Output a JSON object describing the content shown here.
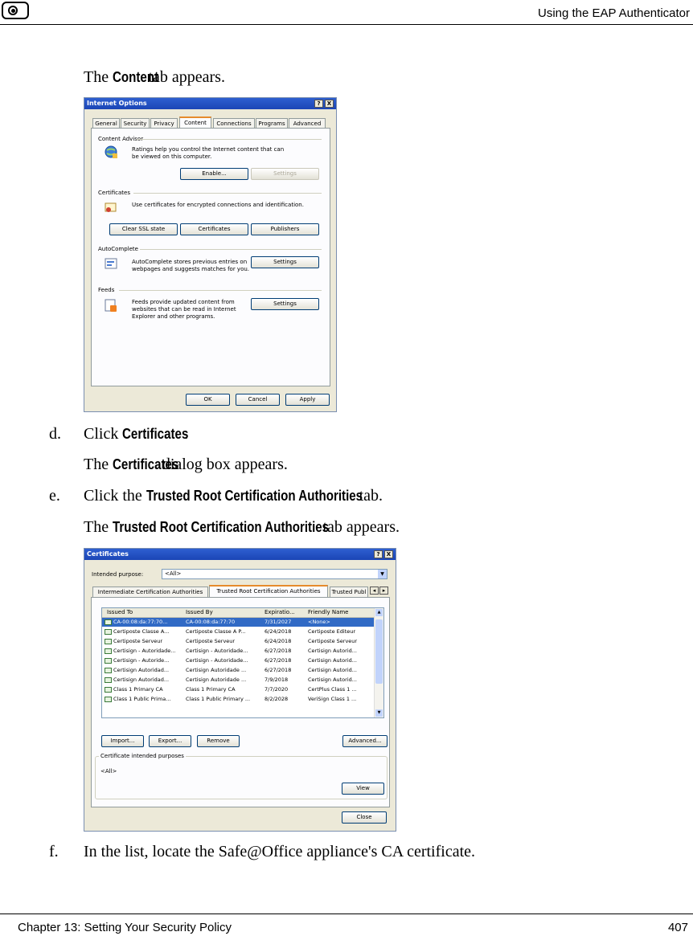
{
  "header": {
    "title": "Using the EAP Authenticator"
  },
  "footer": {
    "chapter": "Chapter 13: Setting Your Security Policy",
    "page": "407"
  },
  "steps": {
    "intro": {
      "pre": "The ",
      "bold": "Content",
      "post": " tab appears."
    },
    "d": {
      "letter": "d.",
      "pre": "Click ",
      "bold": "Certificates",
      "post": ".",
      "sub_pre": "The ",
      "sub_bold": "Certificates",
      "sub_post": " dialog box appears."
    },
    "e": {
      "letter": "e.",
      "pre": "Click the ",
      "bold": "Trusted Root Certification Authorities",
      "post": " tab.",
      "sub_pre": "The ",
      "sub_bold": "Trusted Root Certification Authorities",
      "sub_post": " tab appears."
    },
    "f": {
      "letter": "f.",
      "text": "In the list, locate the Safe@Office appliance's CA certificate."
    }
  },
  "internet_options": {
    "title": "Internet Options",
    "title_buttons": {
      "help": "?",
      "close": "X"
    },
    "tabs": [
      "General",
      "Security",
      "Privacy",
      "Content",
      "Connections",
      "Programs",
      "Advanced"
    ],
    "content_advisor": {
      "label": "Content Advisor",
      "desc": "Ratings help you control the Internet content that can be viewed on this computer.",
      "enable": "Enable...",
      "settings": "Settings"
    },
    "certificates": {
      "label": "Certificates",
      "desc": "Use certificates for encrypted connections and identification.",
      "clear_ssl": "Clear SSL state",
      "certificates": "Certificates",
      "publishers": "Publishers"
    },
    "autocomplete": {
      "label": "AutoComplete",
      "desc": "AutoComplete stores previous entries on webpages and suggests matches for you.",
      "settings": "Settings"
    },
    "feeds": {
      "label": "Feeds",
      "desc": "Feeds provide updated content from websites that can be read in Internet Explorer and other programs.",
      "settings": "Settings"
    },
    "ok": "OK",
    "cancel": "Cancel",
    "apply": "Apply"
  },
  "certificates_dialog": {
    "title": "Certificates",
    "title_buttons": {
      "help": "?",
      "close": "X"
    },
    "intended_label": "Intended purpose:",
    "intended_value": "<All>",
    "tabs": [
      "Intermediate Certification Authorities",
      "Trusted Root Certification Authorities",
      "Trusted Publ"
    ],
    "columns": [
      "Issued To",
      "Issued By",
      "Expiratio...",
      "Friendly Name"
    ],
    "rows": [
      [
        "CA-00:08:da:77:70...",
        "CA-00:08:da:77:70",
        "7/31/2027",
        "<None>"
      ],
      [
        "Certiposte Classe A...",
        "Certiposte Classe A P...",
        "6/24/2018",
        "Certiposte Editeur"
      ],
      [
        "Certiposte Serveur",
        "Certiposte Serveur",
        "6/24/2018",
        "Certiposte Serveur"
      ],
      [
        "Certisign - Autoridade...",
        "Certisign - Autoridade...",
        "6/27/2018",
        "Certisign Autorid..."
      ],
      [
        "Certisign - Autoride...",
        "Certisign - Autoridade...",
        "6/27/2018",
        "Certisign Autorid..."
      ],
      [
        "Certisign Autoridad...",
        "Certisign Autoridade ...",
        "6/27/2018",
        "Certisign Autorid..."
      ],
      [
        "Certisign Autoridad...",
        "Certisign Autoridade ...",
        "7/9/2018",
        "Certisign Autorid..."
      ],
      [
        "Class 1 Primary CA",
        "Class 1 Primary CA",
        "7/7/2020",
        "CertPlus Class 1 ..."
      ],
      [
        "Class 1 Public Prima...",
        "Class 1 Public Primary ...",
        "8/2/2028",
        "VeriSign Class 1 ..."
      ]
    ],
    "import": "Import...",
    "export": "Export...",
    "remove": "Remove",
    "advanced": "Advanced...",
    "purposes_label": "Certificate intended purposes",
    "purposes_value": "<All>",
    "view": "View",
    "close": "Close"
  }
}
